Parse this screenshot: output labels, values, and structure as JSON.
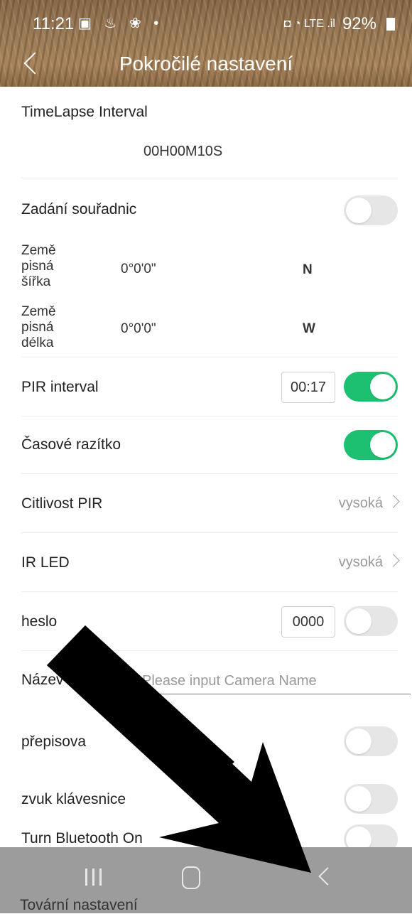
{
  "status": {
    "time": "11:21",
    "left_icons": "▣ ♨ ❀ •",
    "right_icons": "◘ ◔ LTE .il",
    "battery": "92%"
  },
  "header": {
    "title": "Pokročilé nastavení"
  },
  "timelapse": {
    "label": "TimeLapse Interval",
    "value": "00H00M10S"
  },
  "coordinates": {
    "label": "Zadání souřadnic",
    "enabled": false,
    "latitude_label_1": "Země",
    "latitude_label_2": "pisná",
    "latitude_label_3": "šířka",
    "latitude_value": "0°0'0\"",
    "latitude_dir": "N",
    "longitude_label_1": "Země",
    "longitude_label_2": "pisná",
    "longitude_label_3": "délka",
    "longitude_value": "0°0'0\"",
    "longitude_dir": "W"
  },
  "pir_interval": {
    "label": "PIR interval",
    "value": "00:17",
    "enabled": true
  },
  "timestamp": {
    "label": "Časové razítko",
    "enabled": true
  },
  "pir_sensitivity": {
    "label": "Citlivost PIR",
    "value": "vysoká"
  },
  "ir_led": {
    "label": "IR LED",
    "value": "vysoká"
  },
  "password": {
    "label": "heslo",
    "value": "0000",
    "enabled": false
  },
  "camera_name": {
    "label": "Název fo      sti",
    "placeholder": "Please input Camera Name"
  },
  "overwrite": {
    "label": "přepisova",
    "enabled": false
  },
  "key_sound": {
    "label": "zvuk klávesnice",
    "enabled": false
  },
  "bluetooth": {
    "label": "Turn Bluetooth On",
    "enabled": false
  },
  "peek": {
    "label": "Tovární nastavení"
  },
  "colors": {
    "toggle_on": "#1cc070",
    "toggle_off": "#e6e6e6",
    "navbar": "#9c9c9c"
  }
}
